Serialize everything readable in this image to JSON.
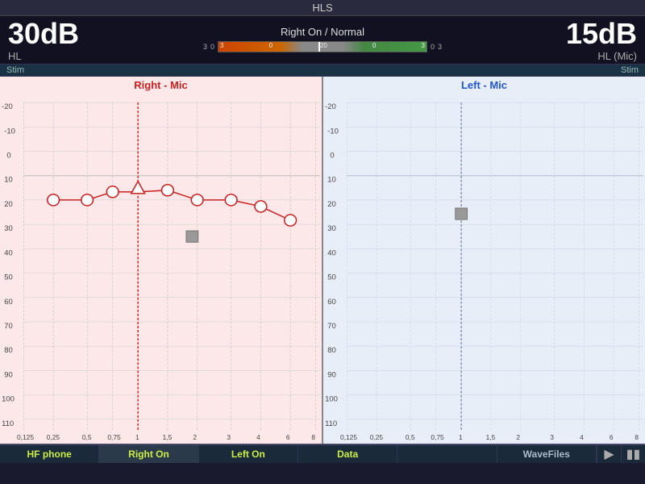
{
  "title": "HLS",
  "header": {
    "left_db": "30dB",
    "left_hl": "HL",
    "right_db": "15dB",
    "right_hl": "HL (Mic)",
    "mode": "Right On / Normal"
  },
  "stim": {
    "left_label": "Stim",
    "right_label": "Stim"
  },
  "charts": {
    "right_title": "Right - Mic",
    "left_title": "Left - Mic"
  },
  "tabs": {
    "items": [
      {
        "id": "hf-phone",
        "label": "HF phone"
      },
      {
        "id": "right-on",
        "label": "Right On"
      },
      {
        "id": "left-on",
        "label": "Left On"
      },
      {
        "id": "data",
        "label": "Data"
      }
    ],
    "right_items": [
      {
        "id": "wave-files",
        "label": "WaveFiles"
      }
    ]
  },
  "vu": {
    "scale_left": "3",
    "scale_mid_left": "0",
    "scale_mid": "-20",
    "scale_mid_right": "0",
    "scale_right": "3"
  }
}
